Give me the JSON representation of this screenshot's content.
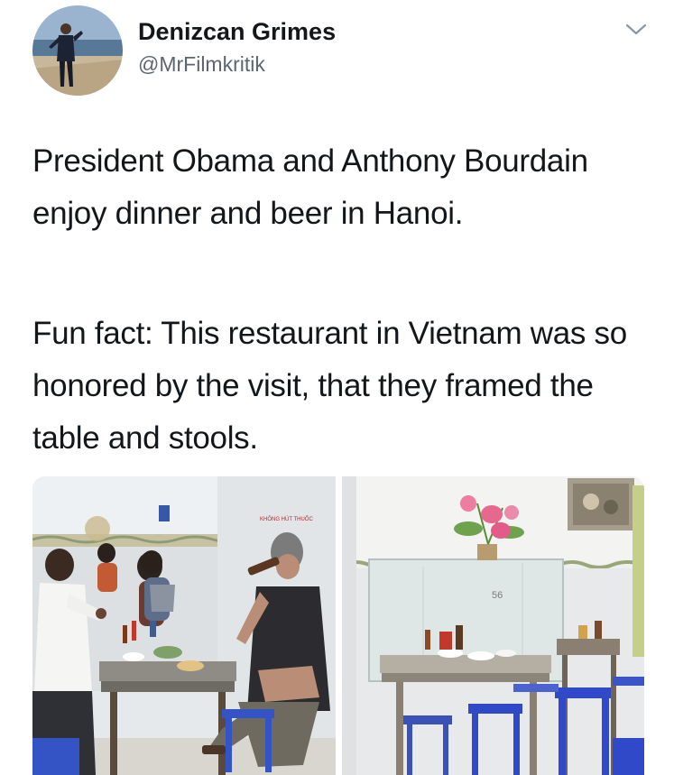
{
  "tweet": {
    "author": {
      "display_name": "Denizcan Grimes",
      "handle": "@MrFilmkritik",
      "avatar_icon": "profile-photo-avatar"
    },
    "menu_icon": "chevron-down-icon",
    "text": {
      "paragraph_1": "President Obama and Anthony Bourdain enjoy dinner and beer in Hanoi.",
      "paragraph_2": "Fun fact: This restaurant in Vietnam was so honored by the visit, that they framed the table and stools."
    },
    "media": {
      "photo_left": {
        "sign_text": "KHÔNG HÚT THUỐC"
      },
      "photo_right": {
        "case_number": "56"
      }
    }
  },
  "colors": {
    "text_primary": "#14171a",
    "text_secondary": "#5c6670",
    "caret": "#8899a6",
    "stool_blue": "#2f49c9"
  }
}
